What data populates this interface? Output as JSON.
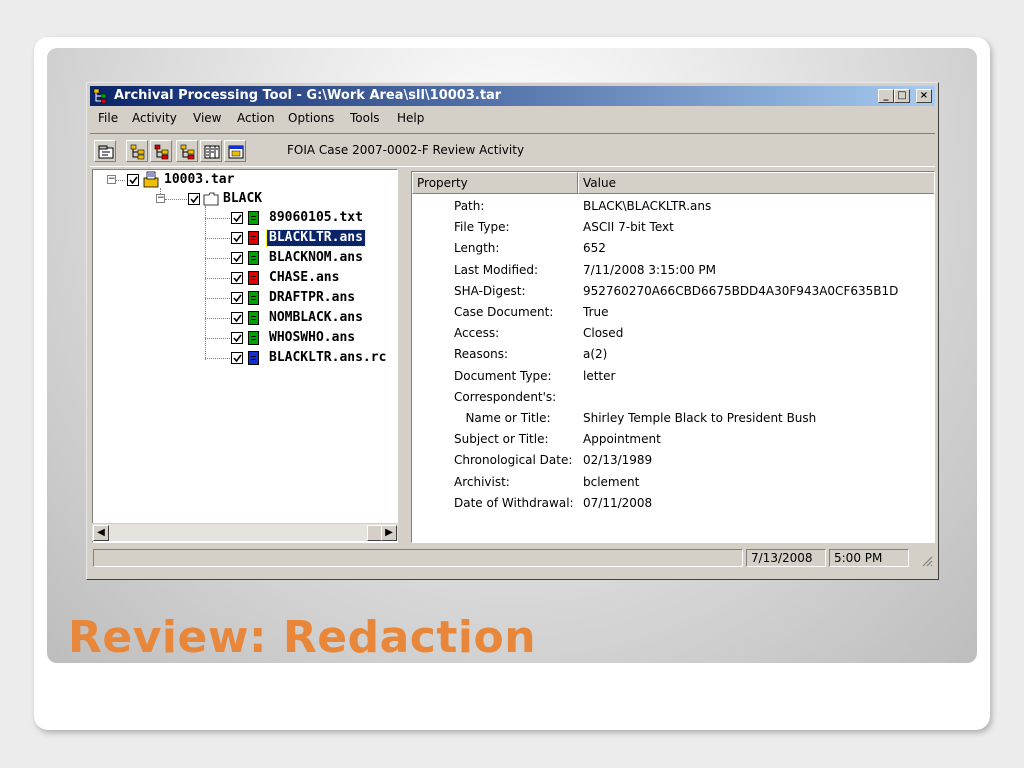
{
  "slide": {
    "title": "Review: Redaction",
    "title_color": "#e8873a"
  },
  "window": {
    "title": "Archival Processing Tool - G:\\Work Area\\sll\\10003.tar",
    "title_icon": "app-tree-icon",
    "controls": {
      "minimize": "_",
      "maximize": "□",
      "close": "×"
    }
  },
  "menu": [
    "File",
    "Activity",
    "View",
    "Action",
    "Options",
    "Tools",
    "Help"
  ],
  "toolbar": {
    "buttons": [
      "properties-icon",
      "tree-yellow-icon",
      "tree-red-icon",
      "tree-yellow-doc-icon",
      "columns-icon",
      "report-icon"
    ],
    "case_label": "FOIA Case 2007-0002-F Review Activity"
  },
  "tree": {
    "root": {
      "label": "10003.tar",
      "checked": true,
      "expanded": true
    },
    "folder": {
      "label": "BLACK",
      "checked": true,
      "expanded": true
    },
    "files": [
      {
        "label": "89060105.txt",
        "color": "#00a000",
        "checked": true,
        "selected": false
      },
      {
        "label": "BLACKLTR.ans",
        "color": "#e00000",
        "checked": true,
        "selected": true
      },
      {
        "label": "BLACKNOM.ans",
        "color": "#00a000",
        "checked": true,
        "selected": false
      },
      {
        "label": "CHASE.ans",
        "color": "#e00000",
        "checked": true,
        "selected": false
      },
      {
        "label": "DRAFTPR.ans",
        "color": "#00a000",
        "checked": true,
        "selected": false
      },
      {
        "label": "NOMBLACK.ans",
        "color": "#00a000",
        "checked": true,
        "selected": false
      },
      {
        "label": "WHOSWHO.ans",
        "color": "#00a000",
        "checked": true,
        "selected": false
      },
      {
        "label": "BLACKLTR.ans.rc",
        "color": "#1030d0",
        "checked": true,
        "selected": false
      }
    ]
  },
  "properties": {
    "headers": {
      "property": "Property",
      "value": "Value"
    },
    "rows": [
      {
        "key": "Path:",
        "value": "BLACK\\BLACKLTR.ans"
      },
      {
        "key": "File Type:",
        "value": "ASCII 7-bit Text"
      },
      {
        "key": "Length:",
        "value": "652"
      },
      {
        "key": "Last Modified:",
        "value": "7/11/2008 3:15:00 PM"
      },
      {
        "key": "SHA-Digest:",
        "value": "952760270A66CBD6675BDD4A30F943A0CF635B1D"
      },
      {
        "key": "Case Document:",
        "value": "True"
      },
      {
        "key": "Access:",
        "value": "Closed"
      },
      {
        "key": "Reasons:",
        "value": "a(2)"
      },
      {
        "key": "Document Type:",
        "value": "letter"
      },
      {
        "key": "Correspondent's:",
        "value": ""
      },
      {
        "key": "   Name or Title:",
        "value": "Shirley Temple Black to President Bush"
      },
      {
        "key": "Subject or Title:",
        "value": "Appointment"
      },
      {
        "key": "Chronological Date:",
        "value": "02/13/1989"
      },
      {
        "key": "Archivist:",
        "value": "bclement"
      },
      {
        "key": "Date of Withdrawal:",
        "value": "07/11/2008"
      }
    ]
  },
  "statusbar": {
    "message": "",
    "date": "7/13/2008",
    "time": "5:00 PM"
  }
}
